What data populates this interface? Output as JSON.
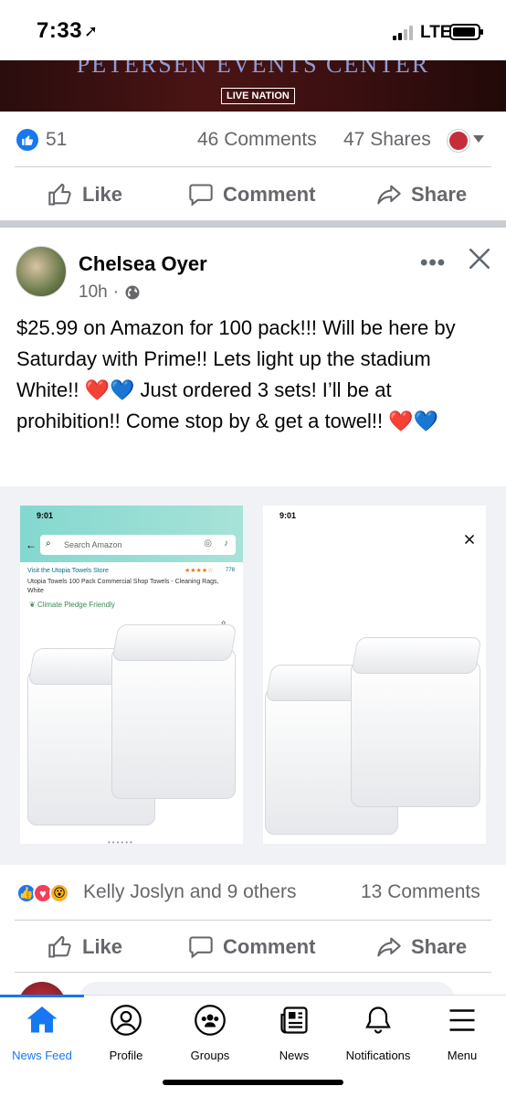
{
  "status_bar": {
    "time": "7:33",
    "network": "LTE"
  },
  "banner": {
    "venue_text": "PETERSEN EVENTS CENTER",
    "badge": "LIVE NATION"
  },
  "prev_post": {
    "like_count": "51",
    "comments": "46 Comments",
    "shares": "47 Shares",
    "actions": {
      "like": "Like",
      "comment": "Comment",
      "share": "Share"
    }
  },
  "post": {
    "author": "Chelsea Oyer",
    "time": "10h",
    "time_separator": "·",
    "text": "$25.99 on Amazon for 100 pack!!! Will be here by Saturday with Prime!! Lets light up the stadium White!! ❤️💙 Just ordered 3 sets! I’ll be at prohibition!! Come stop by & get a towel!! ❤️💙",
    "left_image": {
      "time": "9:01",
      "search_placeholder": "Search Amazon",
      "store_link": "Visit the Utopia Towels Store",
      "rating_count": "778",
      "product_title": "Utopia Towels 100 Pack Commercial Shop Towels - Cleaning Rags, White",
      "climate_badge": "Climate Pledge Friendly"
    },
    "right_image": {
      "time": "9:01"
    },
    "reactions_text": "Kelly Joslyn and 9 others",
    "comments": "13 Comments",
    "actions": {
      "like": "Like",
      "comment": "Comment",
      "share": "Share"
    }
  },
  "tabbar": {
    "items": [
      {
        "label": "News Feed",
        "icon": "home-icon",
        "active": true
      },
      {
        "label": "Profile",
        "icon": "profile-icon"
      },
      {
        "label": "Groups",
        "icon": "groups-icon"
      },
      {
        "label": "News",
        "icon": "news-icon"
      },
      {
        "label": "Notifications",
        "icon": "bell-icon"
      },
      {
        "label": "Menu",
        "icon": "menu-icon"
      }
    ]
  },
  "colors": {
    "accent": "#1877f2",
    "secondary_text": "#65676b",
    "teal_header": "#8fd3d0"
  }
}
